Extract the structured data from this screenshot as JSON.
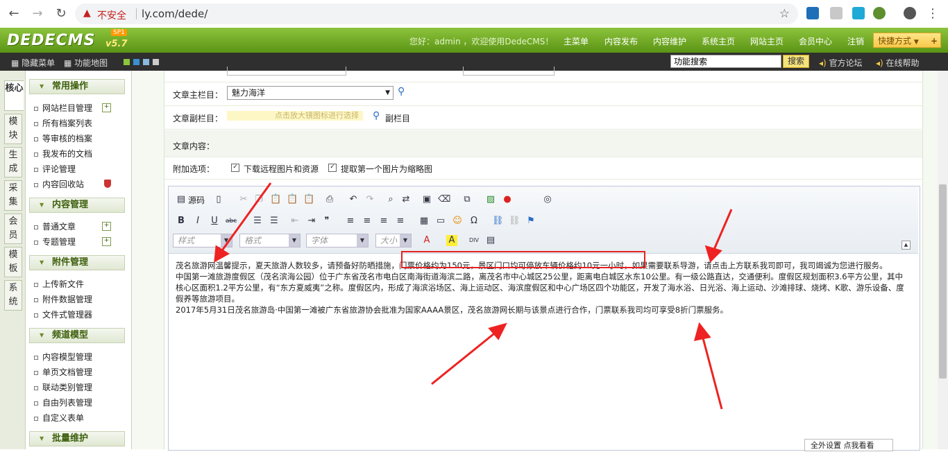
{
  "browser": {
    "insecure_label": "不安全",
    "url": "ly.com/dede/"
  },
  "header": {
    "logo": "DEDECMS",
    "logo_version": "v5.7",
    "logo_sp": "SP1",
    "greeting": "您好：admin ，欢迎使用DedeCMS！",
    "nav": [
      "主菜单",
      "内容发布",
      "内容维护",
      "系统主页",
      "网站主页",
      "会员中心",
      "注销"
    ],
    "quick_menu": "快捷方式"
  },
  "toolbar2": {
    "hide_menu": "隐藏菜单",
    "site_map": "功能地图",
    "search_value": "功能搜索",
    "search_button": "搜索",
    "forum": "官方论坛",
    "help": "在线帮助"
  },
  "left_tabs": [
    "核心",
    "模块",
    "生成",
    "采集",
    "会员",
    "模板",
    "系统"
  ],
  "menu": {
    "groups": [
      {
        "title": "常用操作",
        "items": [
          "网站栏目管理",
          "所有档案列表",
          "等审核的档案",
          "我发布的文档",
          "评论管理",
          "内容回收站"
        ]
      },
      {
        "title": "内容管理",
        "items": [
          "普通文章",
          "专题管理"
        ]
      },
      {
        "title": "附件管理",
        "items": [
          "上传新文件",
          "附件数据管理",
          "文件式管理器"
        ]
      },
      {
        "title": "频道模型",
        "items": [
          "内容模型管理",
          "单页文档管理",
          "联动类别管理",
          "自由列表管理",
          "自定义表单"
        ]
      },
      {
        "title": "批量维护",
        "items": []
      }
    ]
  },
  "form": {
    "main_col_label": "文章主栏目：",
    "main_col_value": "魅力海洋",
    "sub_col_label": "文章副栏目：",
    "sub_col_hint": "点击放大镜图标进行选择",
    "sub_col_link": "副栏目",
    "content_label": "文章内容：",
    "extra_label": "附加选项：",
    "opt_download": "下载远程图片和资源",
    "opt_thumb": "提取第一个图片为缩略图"
  },
  "editor": {
    "source_label": "源码",
    "style_ph": "样式",
    "format_ph": "格式",
    "font_ph": "字体",
    "size_ph": "大小",
    "paragraphs": [
      "茂名旅游网温馨提示，夏天旅游人数较多，请预备好防晒措施，门票价格约为150元，景区门口均可停放车辆价格约10元一小时，如果需要联系导游，请点击上方联系我司即可，我司竭诚为您进行服务。",
      "中国第一滩旅游度假区（茂名滨海公园）位于广东省茂名市电白区南海街道海滨二路，离茂名市中心城区25公里，距离电白城区水东10公里。有一级公路直达，交通便利。度假区规划面积3.6平方公里，其中核心区面积1.2平方公里，有“东方夏威夷”之称。度假区内，形成了海滨浴场区、海上运动区、海滨度假区和中心广场区四个功能区，开发了海水浴、日光浴、海上运动、沙滩排球、烧烤、K歌、游乐设备、度假养等旅游项目。",
      "2017年5月31日茂名旅游岛·中国第一滩被广东省旅游协会批准为国家AAAA景区，茂名旅游网长期与该景点进行合作，门票联系我司均可享受8折门票服务。"
    ],
    "footer_btn": "全外设置 点我看看"
  }
}
